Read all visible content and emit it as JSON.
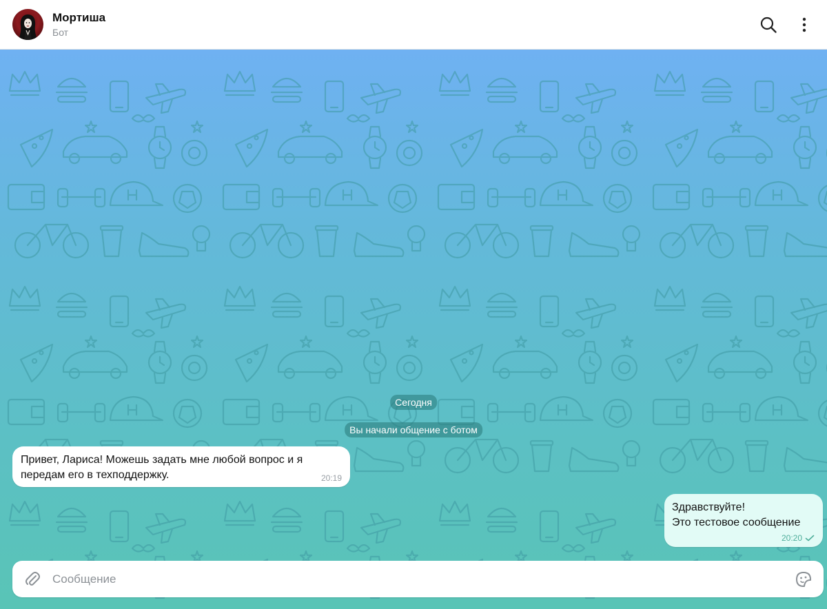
{
  "header": {
    "title": "Мортиша",
    "subtitle": "Бот",
    "avatar_icon": "gothic-lady-avatar",
    "search_icon": "search-icon",
    "menu_icon": "more-vertical-icon"
  },
  "chat": {
    "date_label": "Сегодня",
    "service_message": "Вы начали общение с ботом",
    "messages": [
      {
        "direction": "incoming",
        "text": "Привет, Лариса! Можешь задать мне любой вопрос и я передам его в техподдержку.",
        "time": "20:19"
      },
      {
        "direction": "outgoing",
        "text": "Здравствуйте!\nЭто тестовое сообщение",
        "time": "20:20",
        "status": "sent"
      }
    ]
  },
  "composer": {
    "placeholder": "Сообщение",
    "value": "",
    "attach_icon": "paperclip-icon",
    "sticker_icon": "sticker-icon"
  },
  "colors": {
    "background_top": "#6fb1f2",
    "background_bottom": "#59c4b6",
    "outgoing_bubble": "#e2fbf6",
    "incoming_bubble": "#ffffff"
  }
}
